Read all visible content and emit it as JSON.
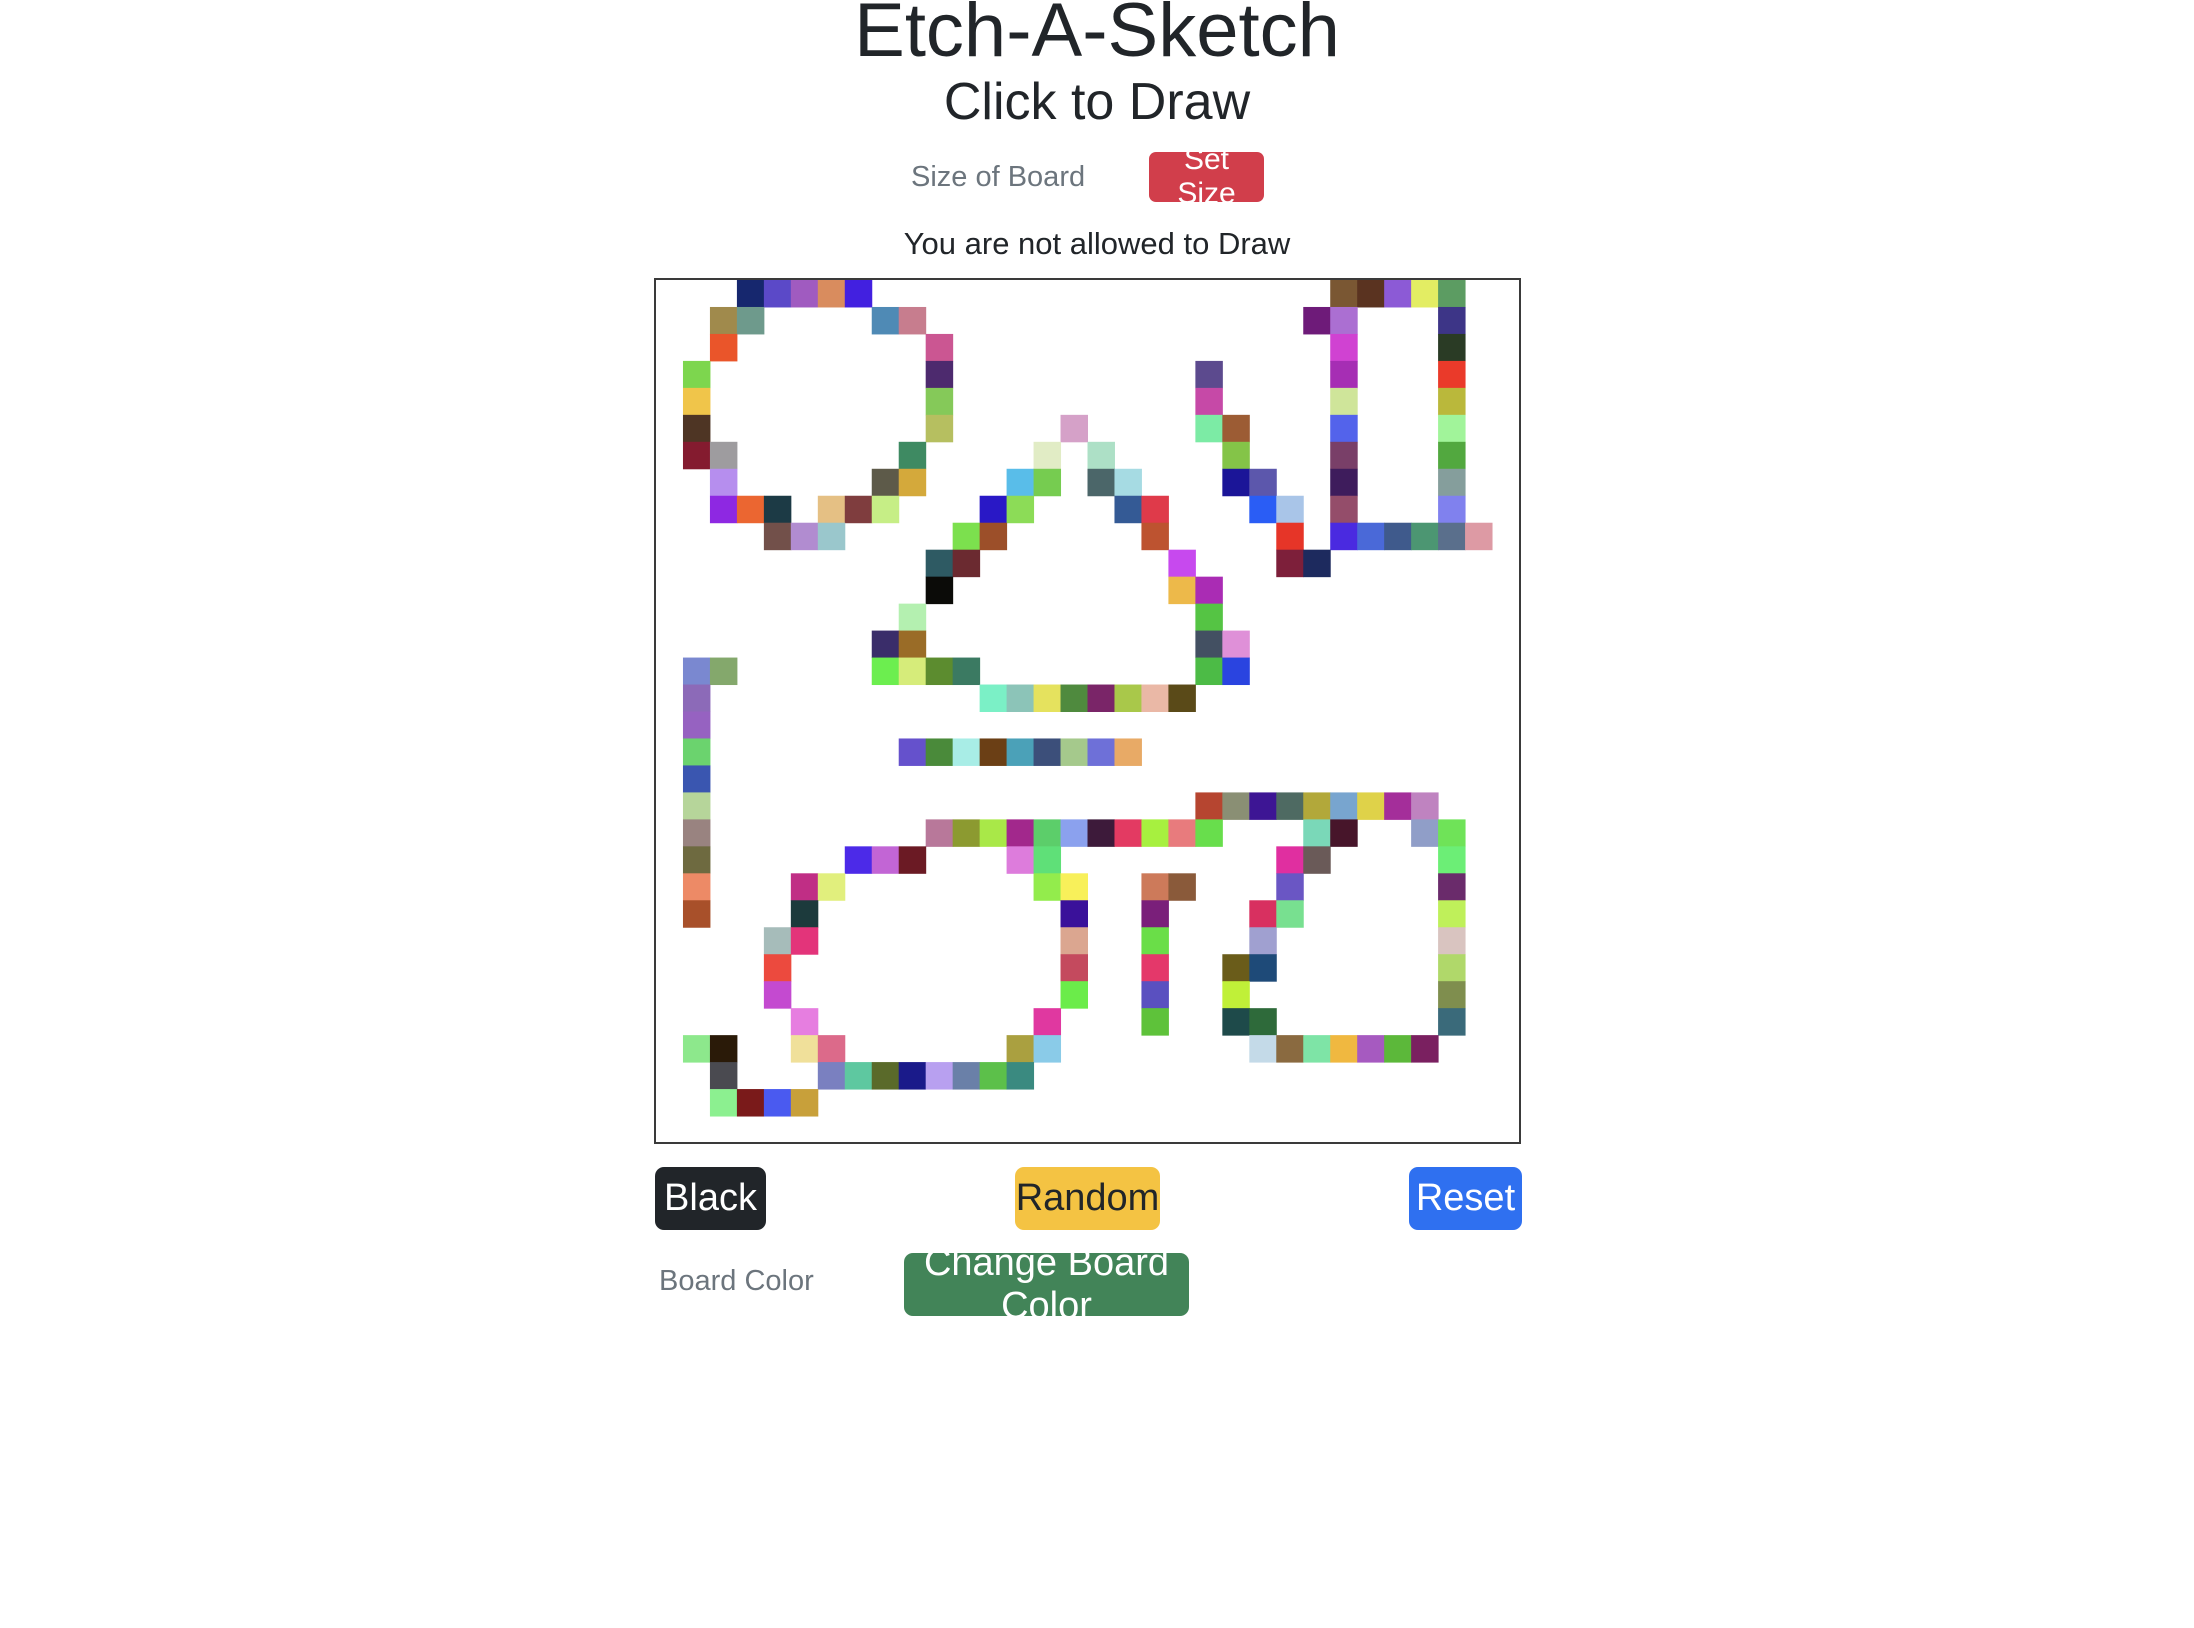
{
  "header": {
    "title": "Etch-A-Sketch",
    "subtitle": "Click to Draw"
  },
  "size_control": {
    "placeholder": "Size of Board",
    "button_label": "Set Size"
  },
  "status_text": "You are not allowed to Draw",
  "board": {
    "background_color": "#ffffff",
    "border_color": "#3a3a3a",
    "grid_size": 32,
    "painted_cells": [
      [
        0,
        3,
        "#16276e"
      ],
      [
        0,
        4,
        "#5b49c8"
      ],
      [
        0,
        5,
        "#a05bc0"
      ],
      [
        0,
        6,
        "#d98c5e"
      ],
      [
        0,
        7,
        "#4220e0"
      ],
      [
        0,
        25,
        "#7a5733"
      ],
      [
        0,
        26,
        "#5a3320"
      ],
      [
        0,
        27,
        "#8c5ad6"
      ],
      [
        0,
        28,
        "#e3ed63"
      ],
      [
        0,
        29,
        "#5c9c62"
      ],
      [
        1,
        2,
        "#a08a4c"
      ],
      [
        1,
        3,
        "#6e9a8c"
      ],
      [
        1,
        8,
        "#4f8ab5"
      ],
      [
        1,
        9,
        "#c77d8e"
      ],
      [
        1,
        24,
        "#6e1b79"
      ],
      [
        1,
        25,
        "#ab6fd2"
      ],
      [
        1,
        29,
        "#3d3587"
      ],
      [
        2,
        2,
        "#ea552a"
      ],
      [
        2,
        10,
        "#cb5692"
      ],
      [
        2,
        25,
        "#d042d2"
      ],
      [
        2,
        29,
        "#2a3b25"
      ],
      [
        3,
        1,
        "#7dd64e"
      ],
      [
        3,
        10,
        "#4d2a6e"
      ],
      [
        3,
        20,
        "#5c4a8e"
      ],
      [
        3,
        25,
        "#a62eb4"
      ],
      [
        3,
        29,
        "#ea3a2a"
      ],
      [
        4,
        1,
        "#f0c54a"
      ],
      [
        4,
        10,
        "#85c959"
      ],
      [
        4,
        20,
        "#c649a7"
      ],
      [
        4,
        25,
        "#cfe59a"
      ],
      [
        4,
        29,
        "#bab83b"
      ],
      [
        5,
        1,
        "#4e3524"
      ],
      [
        5,
        10,
        "#b6bf60"
      ],
      [
        5,
        15,
        "#d5a1c8"
      ],
      [
        5,
        20,
        "#7ceba5"
      ],
      [
        5,
        21,
        "#9c5c34"
      ],
      [
        5,
        25,
        "#5363eb"
      ],
      [
        5,
        29,
        "#a1f49a"
      ],
      [
        6,
        1,
        "#841b2f"
      ],
      [
        6,
        2,
        "#9e9c9f"
      ],
      [
        6,
        9,
        "#3e8a62"
      ],
      [
        6,
        14,
        "#e1ecc5"
      ],
      [
        6,
        16,
        "#ade0c6"
      ],
      [
        6,
        21,
        "#84c448"
      ],
      [
        6,
        25,
        "#793f68"
      ],
      [
        6,
        29,
        "#52a83f"
      ],
      [
        7,
        2,
        "#b68eee"
      ],
      [
        7,
        8,
        "#5d5a49"
      ],
      [
        7,
        9,
        "#d4a93b"
      ],
      [
        7,
        13,
        "#59bde9"
      ],
      [
        7,
        14,
        "#76cc50"
      ],
      [
        7,
        16,
        "#4b6669"
      ],
      [
        7,
        17,
        "#a6dbe3"
      ],
      [
        7,
        21,
        "#1b1598"
      ],
      [
        7,
        22,
        "#5c57ac"
      ],
      [
        7,
        25,
        "#3e1c5c"
      ],
      [
        7,
        29,
        "#859e9c"
      ],
      [
        8,
        2,
        "#8e28e2"
      ],
      [
        8,
        3,
        "#eb6631"
      ],
      [
        8,
        4,
        "#1c3a45"
      ],
      [
        8,
        6,
        "#e5c084"
      ],
      [
        8,
        7,
        "#7f3d3e"
      ],
      [
        8,
        8,
        "#c6ee86"
      ],
      [
        8,
        12,
        "#2918c6"
      ],
      [
        8,
        13,
        "#8cdc57"
      ],
      [
        8,
        17,
        "#345a95"
      ],
      [
        8,
        18,
        "#df3a4a"
      ],
      [
        8,
        22,
        "#2a5df5"
      ],
      [
        8,
        23,
        "#a9c5e8"
      ],
      [
        8,
        25,
        "#944d6a"
      ],
      [
        8,
        29,
        "#8081ee"
      ],
      [
        9,
        4,
        "#72504a"
      ],
      [
        9,
        5,
        "#b18cd0"
      ],
      [
        9,
        6,
        "#9ac7cc"
      ],
      [
        9,
        11,
        "#7ce04e"
      ],
      [
        9,
        12,
        "#9c4f29"
      ],
      [
        9,
        18,
        "#bd5330"
      ],
      [
        9,
        23,
        "#e63528"
      ],
      [
        9,
        25,
        "#4a2ae0"
      ],
      [
        9,
        26,
        "#4a69d8"
      ],
      [
        9,
        27,
        "#3f5a8c"
      ],
      [
        9,
        28,
        "#4c9672"
      ],
      [
        9,
        29,
        "#5a6f8c"
      ],
      [
        9,
        30,
        "#dd9aa4"
      ],
      [
        10,
        10,
        "#2e5a63"
      ],
      [
        10,
        11,
        "#6b2a30"
      ],
      [
        10,
        19,
        "#c749ee"
      ],
      [
        10,
        23,
        "#7d1f3a"
      ],
      [
        10,
        24,
        "#1d2a5e"
      ],
      [
        11,
        10,
        "#0b0b08"
      ],
      [
        11,
        19,
        "#edb94a"
      ],
      [
        11,
        20,
        "#aa2cb4"
      ],
      [
        12,
        9,
        "#b4f0b0"
      ],
      [
        12,
        20,
        "#55c444"
      ],
      [
        13,
        8,
        "#3a2d6a"
      ],
      [
        13,
        9,
        "#9a6c27"
      ],
      [
        13,
        20,
        "#435062"
      ],
      [
        13,
        21,
        "#df90d8"
      ],
      [
        14,
        1,
        "#7a88d0"
      ],
      [
        14,
        2,
        "#84a86c"
      ],
      [
        14,
        8,
        "#6cee4f"
      ],
      [
        14,
        9,
        "#d6ec7a"
      ],
      [
        14,
        10,
        "#5c8c2f"
      ],
      [
        14,
        11,
        "#3b7a62"
      ],
      [
        14,
        20,
        "#4cbb46"
      ],
      [
        14,
        21,
        "#2a44e0"
      ],
      [
        15,
        1,
        "#8c6ab8"
      ],
      [
        15,
        12,
        "#7bf0c6"
      ],
      [
        15,
        13,
        "#8cc4b8"
      ],
      [
        15,
        14,
        "#e5e25e"
      ],
      [
        15,
        15,
        "#4f8a3e"
      ],
      [
        15,
        16,
        "#7a2568"
      ],
      [
        15,
        17,
        "#a9c84a"
      ],
      [
        15,
        18,
        "#eab8a6"
      ],
      [
        15,
        19,
        "#5a4a18"
      ],
      [
        16,
        1,
        "#9662c1"
      ],
      [
        17,
        1,
        "#6bd36e"
      ],
      [
        17,
        9,
        "#6551cc"
      ],
      [
        17,
        10,
        "#4a8a3a"
      ],
      [
        17,
        11,
        "#a8ede6"
      ],
      [
        17,
        12,
        "#6b3f15"
      ],
      [
        17,
        13,
        "#4ba1b8"
      ],
      [
        17,
        14,
        "#3c4f7a"
      ],
      [
        17,
        15,
        "#a5c98c"
      ],
      [
        17,
        16,
        "#6e70d8"
      ],
      [
        17,
        17,
        "#e8aa66"
      ],
      [
        18,
        1,
        "#3a56b0"
      ],
      [
        19,
        1,
        "#b6d59a"
      ],
      [
        19,
        20,
        "#b64530"
      ],
      [
        19,
        21,
        "#8a8f74"
      ],
      [
        19,
        22,
        "#3d1594"
      ],
      [
        19,
        23,
        "#4e6a62"
      ],
      [
        19,
        24,
        "#b2a83a"
      ],
      [
        19,
        25,
        "#78a5cf"
      ],
      [
        19,
        26,
        "#dfd249"
      ],
      [
        19,
        27,
        "#a42e9a"
      ],
      [
        19,
        28,
        "#bf83c0"
      ],
      [
        20,
        1,
        "#998380"
      ],
      [
        20,
        10,
        "#b8789a"
      ],
      [
        20,
        11,
        "#8c9a30"
      ],
      [
        20,
        12,
        "#a9e848"
      ],
      [
        20,
        13,
        "#a2288c"
      ],
      [
        20,
        14,
        "#5cce6a"
      ],
      [
        20,
        15,
        "#8ba1ee"
      ],
      [
        20,
        16,
        "#3d1a3a"
      ],
      [
        20,
        17,
        "#e33a62"
      ],
      [
        20,
        18,
        "#a7f03f"
      ],
      [
        20,
        19,
        "#e87b7d"
      ],
      [
        20,
        20,
        "#68de4c"
      ],
      [
        20,
        24,
        "#7ad8b8"
      ],
      [
        20,
        25,
        "#47152a"
      ],
      [
        20,
        28,
        "#909ec8"
      ],
      [
        20,
        29,
        "#6fe358"
      ],
      [
        21,
        1,
        "#6e6a40"
      ],
      [
        21,
        7,
        "#4c2ae8"
      ],
      [
        21,
        8,
        "#c265d5"
      ],
      [
        21,
        9,
        "#6b1a24"
      ],
      [
        21,
        13,
        "#dd7cdc"
      ],
      [
        21,
        14,
        "#5fe078"
      ],
      [
        21,
        23,
        "#e02fa0"
      ],
      [
        21,
        24,
        "#6a5a58"
      ],
      [
        21,
        29,
        "#6cee76"
      ],
      [
        22,
        1,
        "#ed8a66"
      ],
      [
        22,
        5,
        "#c02e85"
      ],
      [
        22,
        6,
        "#e1ef7d"
      ],
      [
        22,
        14,
        "#93ec4c"
      ],
      [
        22,
        15,
        "#f8f05a"
      ],
      [
        22,
        18,
        "#cd7a5a"
      ],
      [
        22,
        19,
        "#8a5a3a"
      ],
      [
        22,
        23,
        "#6a56c4"
      ],
      [
        22,
        29,
        "#6a2b6b"
      ],
      [
        23,
        1,
        "#a8502a"
      ],
      [
        23,
        5,
        "#1c3a3c"
      ],
      [
        23,
        15,
        "#3a119a"
      ],
      [
        23,
        18,
        "#7a1f7a"
      ],
      [
        23,
        22,
        "#d83060"
      ],
      [
        23,
        23,
        "#78e090"
      ],
      [
        23,
        29,
        "#bff05a"
      ],
      [
        24,
        4,
        "#a6bcba"
      ],
      [
        24,
        5,
        "#e3347a"
      ],
      [
        24,
        15,
        "#dba690"
      ],
      [
        24,
        18,
        "#6ade48"
      ],
      [
        24,
        22,
        "#a0a0d0"
      ],
      [
        24,
        29,
        "#d9c4c0"
      ],
      [
        25,
        4,
        "#ec4a3e"
      ],
      [
        25,
        15,
        "#c44a5e"
      ],
      [
        25,
        18,
        "#e4386a"
      ],
      [
        25,
        21,
        "#6a5c1a"
      ],
      [
        25,
        22,
        "#1e4a78"
      ],
      [
        25,
        29,
        "#b0d86a"
      ],
      [
        26,
        4,
        "#c44ad0"
      ],
      [
        26,
        15,
        "#6bec4a"
      ],
      [
        26,
        18,
        "#5a50c0"
      ],
      [
        26,
        21,
        "#c0f038"
      ],
      [
        26,
        29,
        "#7f8e4e"
      ],
      [
        27,
        5,
        "#e67ee0"
      ],
      [
        27,
        14,
        "#e038a0"
      ],
      [
        27,
        18,
        "#5ec23a"
      ],
      [
        27,
        21,
        "#1e4a4a"
      ],
      [
        27,
        22,
        "#2e6a3a"
      ],
      [
        27,
        29,
        "#3a6a7a"
      ],
      [
        28,
        1,
        "#8de88c"
      ],
      [
        28,
        2,
        "#2a1a08"
      ],
      [
        28,
        5,
        "#f0e09a"
      ],
      [
        28,
        6,
        "#dc6a8a"
      ],
      [
        28,
        13,
        "#aaa040"
      ],
      [
        28,
        14,
        "#8acbe8"
      ],
      [
        28,
        22,
        "#c4dae8"
      ],
      [
        28,
        23,
        "#8a6a40"
      ],
      [
        28,
        24,
        "#7ee4a6"
      ],
      [
        28,
        25,
        "#f0b840"
      ],
      [
        28,
        26,
        "#a65ac0"
      ],
      [
        28,
        27,
        "#5cb83a"
      ],
      [
        28,
        28,
        "#7a2060"
      ],
      [
        29,
        2,
        "#4a4a50"
      ],
      [
        29,
        6,
        "#7a80c0"
      ],
      [
        29,
        7,
        "#5ec8a0"
      ],
      [
        29,
        8,
        "#5a6a2a"
      ],
      [
        29,
        9,
        "#1a1a8a"
      ],
      [
        29,
        10,
        "#b8a0f0"
      ],
      [
        29,
        11,
        "#6a80a8"
      ],
      [
        29,
        12,
        "#5cc04a"
      ],
      [
        29,
        13,
        "#3a8a80"
      ],
      [
        30,
        2,
        "#8cf090"
      ],
      [
        30,
        3,
        "#7a1a1a"
      ],
      [
        30,
        4,
        "#4a5af0"
      ],
      [
        30,
        5,
        "#c8a03a"
      ]
    ]
  },
  "buttons": {
    "black": "Black",
    "random": "Random",
    "reset": "Reset"
  },
  "board_color_control": {
    "placeholder": "Board Color",
    "button_label": "Change Board Color"
  },
  "colors": {
    "black_button": "#212529",
    "random_button": "#f4c343",
    "reset_button": "#2f70f0",
    "set_size_button": "#d13e4b",
    "change_board_color_button": "#428458"
  }
}
